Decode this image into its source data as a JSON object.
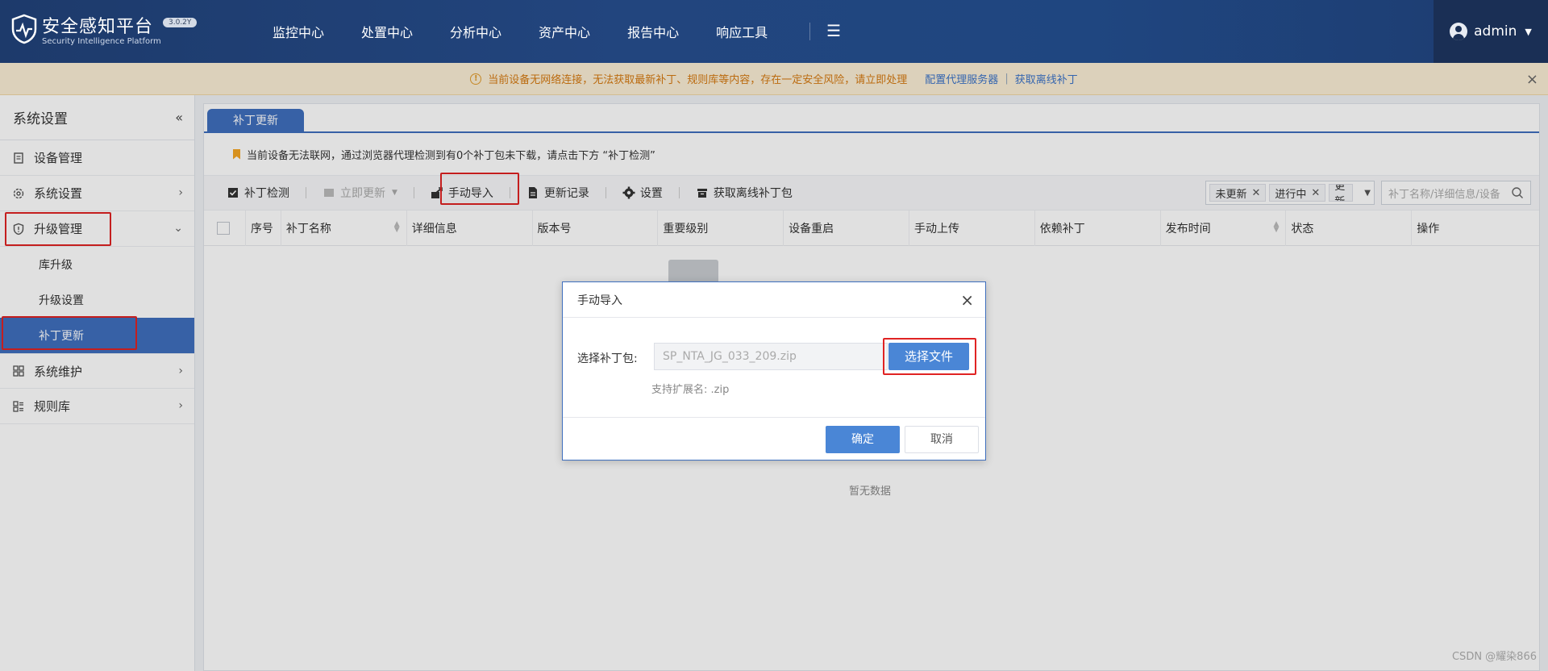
{
  "header": {
    "brand_title": "安全感知平台",
    "brand_subtitle": "Security Intelligence Platform",
    "version": "3.0.2Y",
    "nav": [
      "监控中心",
      "处置中心",
      "分析中心",
      "资产中心",
      "报告中心",
      "响应工具"
    ],
    "more_icon": "menu-icon",
    "user": "admin"
  },
  "warning": {
    "text": "当前设备无网络连接，无法获取最新补丁、规则库等内容，存在一定安全风险，请立即处理",
    "link1": "配置代理服务器",
    "separator": "|",
    "link2": "获取离线补丁"
  },
  "sidebar": {
    "title": "系统设置",
    "items": [
      {
        "label": "设备管理",
        "icon": "device-icon"
      },
      {
        "label": "系统设置",
        "icon": "gear-icon"
      },
      {
        "label": "升级管理",
        "icon": "shield-icon"
      },
      {
        "label": "系统维护",
        "icon": "grid-icon"
      },
      {
        "label": "规则库",
        "icon": "rules-icon"
      }
    ],
    "subitems": [
      "库升级",
      "升级设置",
      "补丁更新"
    ]
  },
  "main": {
    "tab": "补丁更新",
    "notice": "当前设备无法联网，通过浏览器代理检测到有0个补丁包未下载，请点击下方 “补丁检测”",
    "toolbar": {
      "check": "补丁检测",
      "update_now": "立即更新",
      "manual_import": "手动导入",
      "history": "更新记录",
      "settings": "设置",
      "offline": "获取离线补丁包"
    },
    "filters": {
      "chips": [
        "未更新",
        "进行中",
        "更新"
      ],
      "search_placeholder": "补丁名称/详细信息/设备"
    },
    "columns": [
      "序号",
      "补丁名称",
      "详细信息",
      "版本号",
      "重要级别",
      "设备重启",
      "手动上传",
      "依赖补丁",
      "发布时间",
      "状态",
      "操作"
    ],
    "empty": "暂无数据"
  },
  "modal": {
    "title": "手动导入",
    "label": "选择补丁包:",
    "file_value": "SP_NTA_JG_033_209.zip",
    "choose": "选择文件",
    "hint": "支持扩展名: .zip",
    "ok": "确定",
    "cancel": "取消"
  },
  "watermark": "CSDN @耀染866",
  "colors": {
    "header": "#1f4680",
    "accent": "#3f6fbe",
    "button": "#4a86d6",
    "warning_bg": "#fbeed5",
    "highlight": "#e02323"
  }
}
